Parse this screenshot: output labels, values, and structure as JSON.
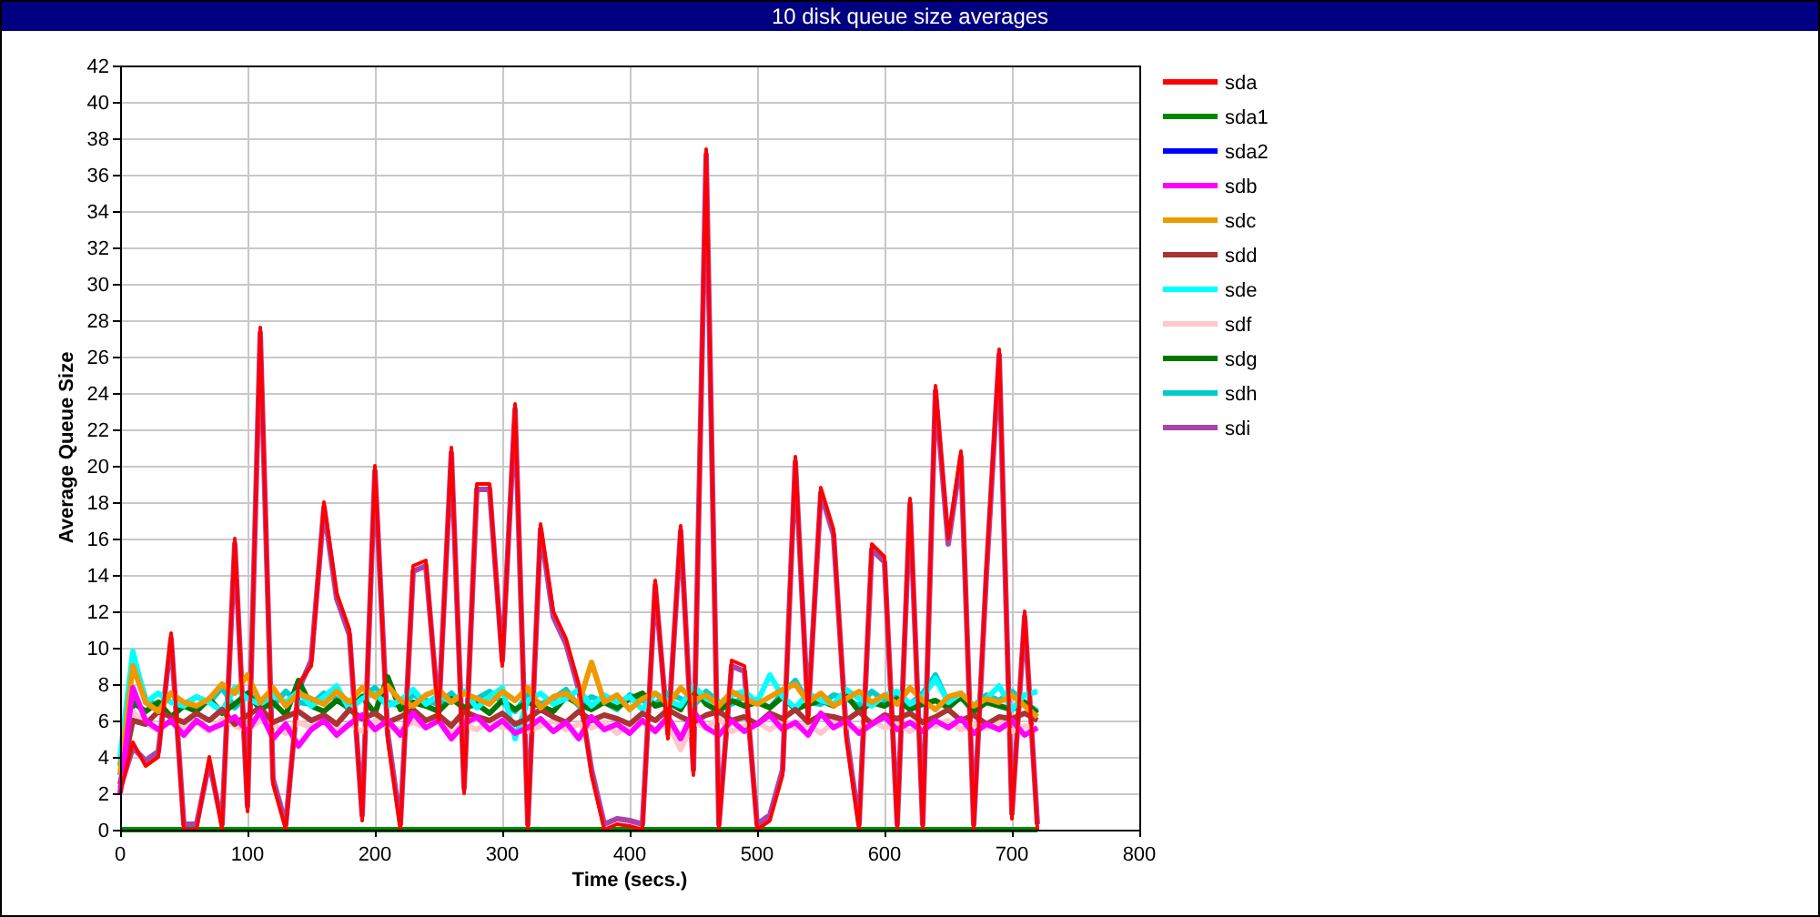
{
  "chart": {
    "chart_data": {
      "type": "line",
      "title": "10 disk queue size averages",
      "xlabel": "Time (secs.)",
      "ylabel": "Average Queue Size",
      "x": [
        0,
        10,
        20,
        30,
        40,
        50,
        60,
        70,
        80,
        90,
        100,
        110,
        120,
        130,
        140,
        150,
        160,
        170,
        180,
        190,
        200,
        210,
        220,
        230,
        240,
        250,
        260,
        270,
        280,
        290,
        300,
        310,
        320,
        330,
        340,
        350,
        360,
        370,
        380,
        390,
        400,
        410,
        420,
        430,
        440,
        450,
        460,
        470,
        480,
        490,
        500,
        510,
        520,
        530,
        540,
        550,
        560,
        570,
        580,
        590,
        600,
        610,
        620,
        630,
        640,
        650,
        660,
        670,
        680,
        690,
        700,
        710,
        720
      ],
      "xlim": [
        0,
        800
      ],
      "ylim": [
        0,
        42
      ],
      "grid": true,
      "legend": true,
      "xticks": [
        0,
        100,
        200,
        300,
        400,
        500,
        600,
        700,
        800
      ],
      "yticks": [
        0,
        2,
        4,
        6,
        8,
        10,
        12,
        14,
        16,
        18,
        20,
        22,
        24,
        26,
        28,
        30,
        32,
        34,
        36,
        38,
        40,
        42
      ],
      "series": [
        {
          "name": "sda",
          "color": "#ff0000",
          "values": [
            2,
            4.8,
            3.5,
            4,
            10.8,
            0,
            0,
            4,
            0,
            16,
            1,
            27.6,
            2.5,
            0,
            8,
            9,
            18,
            13,
            11,
            0.5,
            20,
            5,
            0,
            14.5,
            14.8,
            6,
            21,
            2,
            19,
            19,
            9,
            23.4,
            0,
            16.8,
            12,
            10.5,
            8,
            3,
            0,
            0.3,
            0.2,
            0,
            13.7,
            5,
            16.7,
            3,
            37.4,
            0,
            9.3,
            9,
            0,
            0.5,
            3,
            20.5,
            6,
            18.8,
            16.5,
            5,
            0,
            15.7,
            15,
            0,
            18.2,
            0,
            24.4,
            16,
            20.8,
            0,
            14.4,
            26.4,
            0.6,
            12,
            0
          ]
        },
        {
          "name": "sda1",
          "color": "#008800",
          "values": [
            0,
            0,
            0,
            0,
            0,
            0,
            0,
            0,
            0,
            0,
            0,
            0,
            0,
            0,
            0,
            0,
            0,
            0,
            0,
            0,
            0,
            0,
            0,
            0,
            0,
            0,
            0,
            0,
            0,
            0,
            0,
            0,
            0,
            0,
            0,
            0,
            0,
            0,
            0,
            0,
            0,
            0,
            0,
            0,
            0,
            0,
            0,
            0,
            0,
            0,
            0,
            0,
            0,
            0,
            0,
            0,
            0,
            0,
            0,
            0,
            0,
            0,
            0,
            0,
            0,
            0,
            0,
            0,
            0,
            0,
            0,
            0,
            0
          ]
        },
        {
          "name": "sda2",
          "color": "#0000ff",
          "values": [
            null,
            null,
            null,
            null,
            null,
            null,
            null,
            null,
            null,
            null,
            null,
            null,
            null,
            null,
            null,
            null,
            null,
            null,
            null,
            null,
            null,
            null,
            null,
            null,
            null,
            null,
            null,
            null,
            null,
            null,
            null,
            null,
            null,
            null,
            null,
            null,
            null,
            null,
            null,
            null,
            null,
            null,
            null,
            null,
            null,
            null,
            null,
            null,
            null,
            null,
            null,
            null,
            null,
            null,
            null,
            null,
            null,
            null,
            null,
            null,
            null,
            null,
            null,
            null,
            null,
            null,
            null,
            null,
            null,
            null,
            null,
            null,
            null
          ]
        },
        {
          "name": "sdb",
          "color": "#ff00ff",
          "values": [
            2,
            7.8,
            6,
            5.5,
            6,
            5.2,
            6,
            5.5,
            5.8,
            6.2,
            5.4,
            6.5,
            5,
            5.8,
            4.6,
            5.5,
            6,
            5.2,
            5.8,
            6.3,
            5.5,
            6,
            5.2,
            6.4,
            5.6,
            6,
            5,
            5.8,
            6.2,
            5.5,
            6,
            5.3,
            5.6,
            6.1,
            5.4,
            5.9,
            5,
            6.2,
            5.5,
            5.8,
            5.3,
            6,
            5.4,
            6.2,
            5,
            6.5,
            5.6,
            5.2,
            6,
            5.4,
            5.8,
            6.3,
            5.5,
            5.9,
            5.2,
            6.4,
            5.6,
            6,
            5.3,
            5.8,
            6.2,
            5.5,
            5.9,
            5.4,
            6,
            5.6,
            6.1,
            5.3,
            5.8,
            5.5,
            6,
            5.2,
            5.6
          ]
        },
        {
          "name": "sdc",
          "color": "#ee9900",
          "values": [
            3,
            9,
            7,
            6.5,
            7.5,
            7,
            6.8,
            7.2,
            8,
            7.5,
            8.5,
            7,
            7.8,
            6.8,
            7.5,
            7.2,
            6.9,
            7.6,
            7,
            7.8,
            7.3,
            7.9,
            7.1,
            6.8,
            7.4,
            7.7,
            7,
            7.5,
            7.2,
            6.9,
            7.6,
            7.1,
            7.8,
            6.7,
            7.3,
            7.5,
            6.9,
            9.2,
            7,
            7.4,
            6.6,
            7.2,
            7.5,
            6.9,
            7.8,
            7.1,
            7.4,
            6.8,
            7.6,
            7.2,
            6.9,
            7.3,
            7.7,
            8,
            7,
            7.5,
            6.8,
            7.2,
            7.6,
            7,
            7.4,
            6.9,
            7.8,
            7.1,
            6.6,
            7.3,
            7.5,
            6.8,
            7.2,
            7,
            7.4,
            6.8,
            6.2
          ]
        },
        {
          "name": "sdd",
          "color": "#aa3333",
          "values": [
            2.5,
            6,
            5.8,
            6.5,
            6.2,
            5.9,
            6.4,
            6,
            6.6,
            5.8,
            6.3,
            6.7,
            5.9,
            6.2,
            6.5,
            6,
            6.3,
            5.8,
            6.6,
            6.1,
            6.4,
            5.9,
            6.2,
            6.6,
            6,
            6.3,
            5.7,
            6.5,
            6.2,
            6,
            6.4,
            5.8,
            6.1,
            6.6,
            6.2,
            5.9,
            6.5,
            6,
            6.3,
            6.1,
            5.8,
            6.4,
            6,
            6.6,
            6.2,
            5.9,
            6.3,
            6.5,
            6,
            6.2,
            5.8,
            6.4,
            6.1,
            6.6,
            5.9,
            6.3,
            6.2,
            6,
            6.5,
            5.8,
            6.3,
            6.1,
            6.4,
            5.9,
            6.2,
            6.6,
            6,
            6.3,
            5.8,
            6.2,
            6.1,
            6.4,
            6
          ]
        },
        {
          "name": "sde",
          "color": "#00ffff",
          "values": [
            4,
            9.8,
            7,
            7.5,
            7,
            6.8,
            7.3,
            7,
            6.5,
            7.8,
            7.2,
            6.9,
            7.4,
            7,
            7.6,
            6.8,
            7.3,
            7.9,
            6.6,
            7.2,
            7.5,
            6.8,
            7.1,
            7.7,
            6.9,
            7.4,
            7,
            7.6,
            6.7,
            7.3,
            7.8,
            5,
            7.1,
            7.5,
            6.9,
            7.2,
            7.7,
            6.8,
            7.4,
            7,
            7.3,
            6.6,
            7.5,
            7.1,
            6.8,
            7.9,
            7.2,
            6.9,
            7.4,
            7.6,
            7,
            8.5,
            7.3,
            6.7,
            7.5,
            7.1,
            6.9,
            7.7,
            7.2,
            6.8,
            7.4,
            7.6,
            6.9,
            7.3,
            8.3,
            7,
            7.5,
            6.8,
            7.2,
            7.9,
            6.6,
            7.4,
            7.6
          ]
        },
        {
          "name": "sdf",
          "color": "#ffc8cc",
          "values": [
            3,
            6.5,
            5.8,
            5.5,
            6,
            5.6,
            5.9,
            5.4,
            6.1,
            5.7,
            5.5,
            6,
            5.8,
            5.3,
            5.9,
            5.6,
            6.2,
            5.5,
            5.8,
            5.4,
            6,
            5.7,
            5.5,
            5.9,
            5.6,
            6.1,
            5.3,
            5.8,
            5.5,
            6,
            5.6,
            5.9,
            5.4,
            5.7,
            6,
            5.5,
            5.8,
            5.6,
            5.9,
            5.3,
            5.7,
            6,
            5.5,
            5.8,
            4.4,
            5.9,
            5.6,
            6.1,
            5.4,
            5.7,
            5.9,
            5.5,
            6,
            5.6,
            5.8,
            5.3,
            5.9,
            5.7,
            5.5,
            6,
            5.6,
            5.8,
            5.4,
            5.9,
            5.7,
            6,
            5.5,
            5.8,
            5.6,
            5.9,
            5.4,
            5.7,
            5.5
          ]
        },
        {
          "name": "sdg",
          "color": "#007700",
          "values": [
            3,
            7,
            6.5,
            7,
            6.2,
            6.8,
            6.5,
            7.2,
            6.4,
            6.9,
            7.5,
            6.6,
            7,
            6.3,
            8.2,
            6.8,
            6.5,
            7.1,
            6.7,
            7.3,
            6.4,
            8.4,
            6.6,
            7,
            6.8,
            6.5,
            7.2,
            6.7,
            6.9,
            6.4,
            7.1,
            6.6,
            7,
            6.8,
            6.5,
            7.3,
            6.9,
            6.6,
            7,
            6.7,
            7.2,
            7.5,
            6.8,
            7,
            6.6,
            7.8,
            6.9,
            6.5,
            7.1,
            6.8,
            7,
            6.7,
            7.3,
            6.6,
            6.9,
            7.1,
            6.8,
            7.4,
            6.5,
            7,
            6.8,
            7.2,
            6.6,
            6.9,
            7.1,
            6.7,
            7.3,
            6.5,
            7,
            6.8,
            6.6,
            7,
            6.4
          ]
        },
        {
          "name": "sdh",
          "color": "#00cccc",
          "values": [
            3.5,
            9.5,
            7.2,
            6.8,
            7.5,
            6.9,
            7.3,
            7,
            7.8,
            6.7,
            7.4,
            7.1,
            6.8,
            7.6,
            7,
            6.9,
            7.5,
            7.2,
            6.6,
            7.3,
            7.8,
            7,
            6.8,
            7.4,
            7.1,
            6.9,
            7.5,
            6.7,
            7.2,
            7.6,
            7,
            6.5,
            7.4,
            6.9,
            7.2,
            7.7,
            6.8,
            7.3,
            7,
            6.6,
            7.4,
            7.1,
            6.9,
            7.5,
            7.2,
            6.8,
            7.6,
            7,
            6.9,
            7.3,
            7.1,
            6.7,
            7.5,
            8.2,
            7,
            6.9,
            7.4,
            7.2,
            6.8,
            7.6,
            7.1,
            7.3,
            6.9,
            7.5,
            8.5,
            7,
            7.2,
            6.8,
            7.4,
            7.1,
            7.6,
            7,
            6.5
          ]
        },
        {
          "name": "sdi",
          "color": "#aa44aa",
          "values": [
            2.3,
            4.5,
            3.8,
            4.3,
            10.5,
            0.3,
            0.3,
            3.7,
            0.3,
            15.7,
            1.3,
            27.3,
            2.8,
            0.3,
            7.7,
            9.3,
            17.7,
            12.7,
            10.7,
            0.8,
            19.7,
            5.3,
            0.3,
            14.2,
            14.5,
            6.3,
            20.7,
            2.3,
            18.7,
            18.7,
            9.3,
            23.1,
            0.3,
            16.5,
            11.7,
            10.2,
            7.7,
            3.3,
            0.3,
            0.6,
            0.5,
            0.3,
            13.4,
            5.3,
            16.4,
            3.3,
            37.1,
            0.3,
            9,
            8.7,
            0.3,
            0.8,
            3.3,
            20.2,
            6.3,
            18.5,
            16.2,
            5.3,
            0.3,
            15.4,
            14.7,
            0.3,
            17.9,
            0.3,
            24.1,
            15.7,
            20.5,
            0.3,
            14.1,
            26.1,
            0.9,
            11.7,
            0.3
          ]
        }
      ]
    }
  }
}
